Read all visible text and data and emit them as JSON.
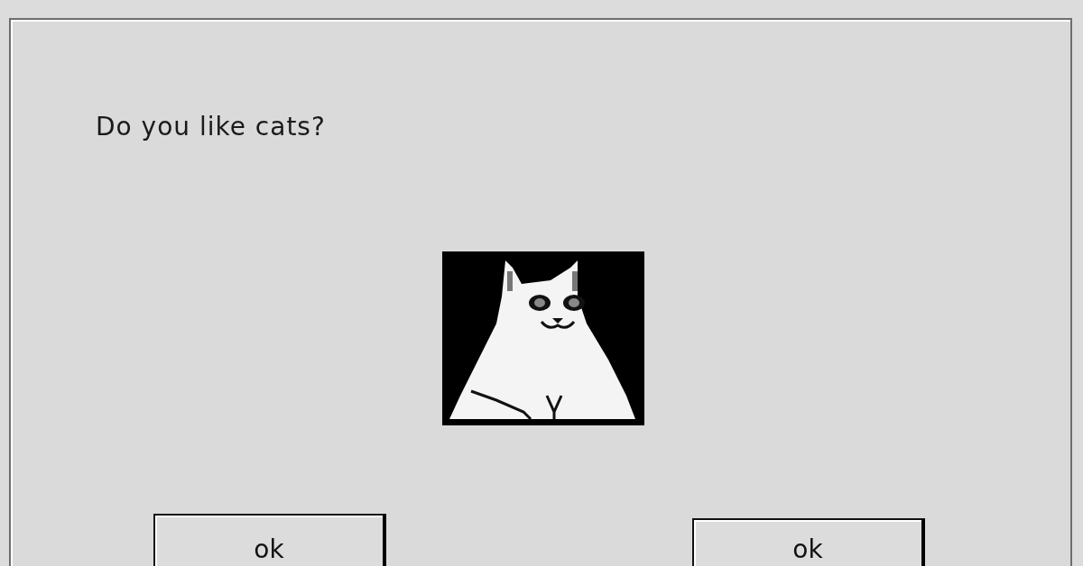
{
  "dialog": {
    "question": "Do you like cats?",
    "buttons": [
      {
        "label": "ok"
      },
      {
        "label": "ok"
      }
    ]
  }
}
